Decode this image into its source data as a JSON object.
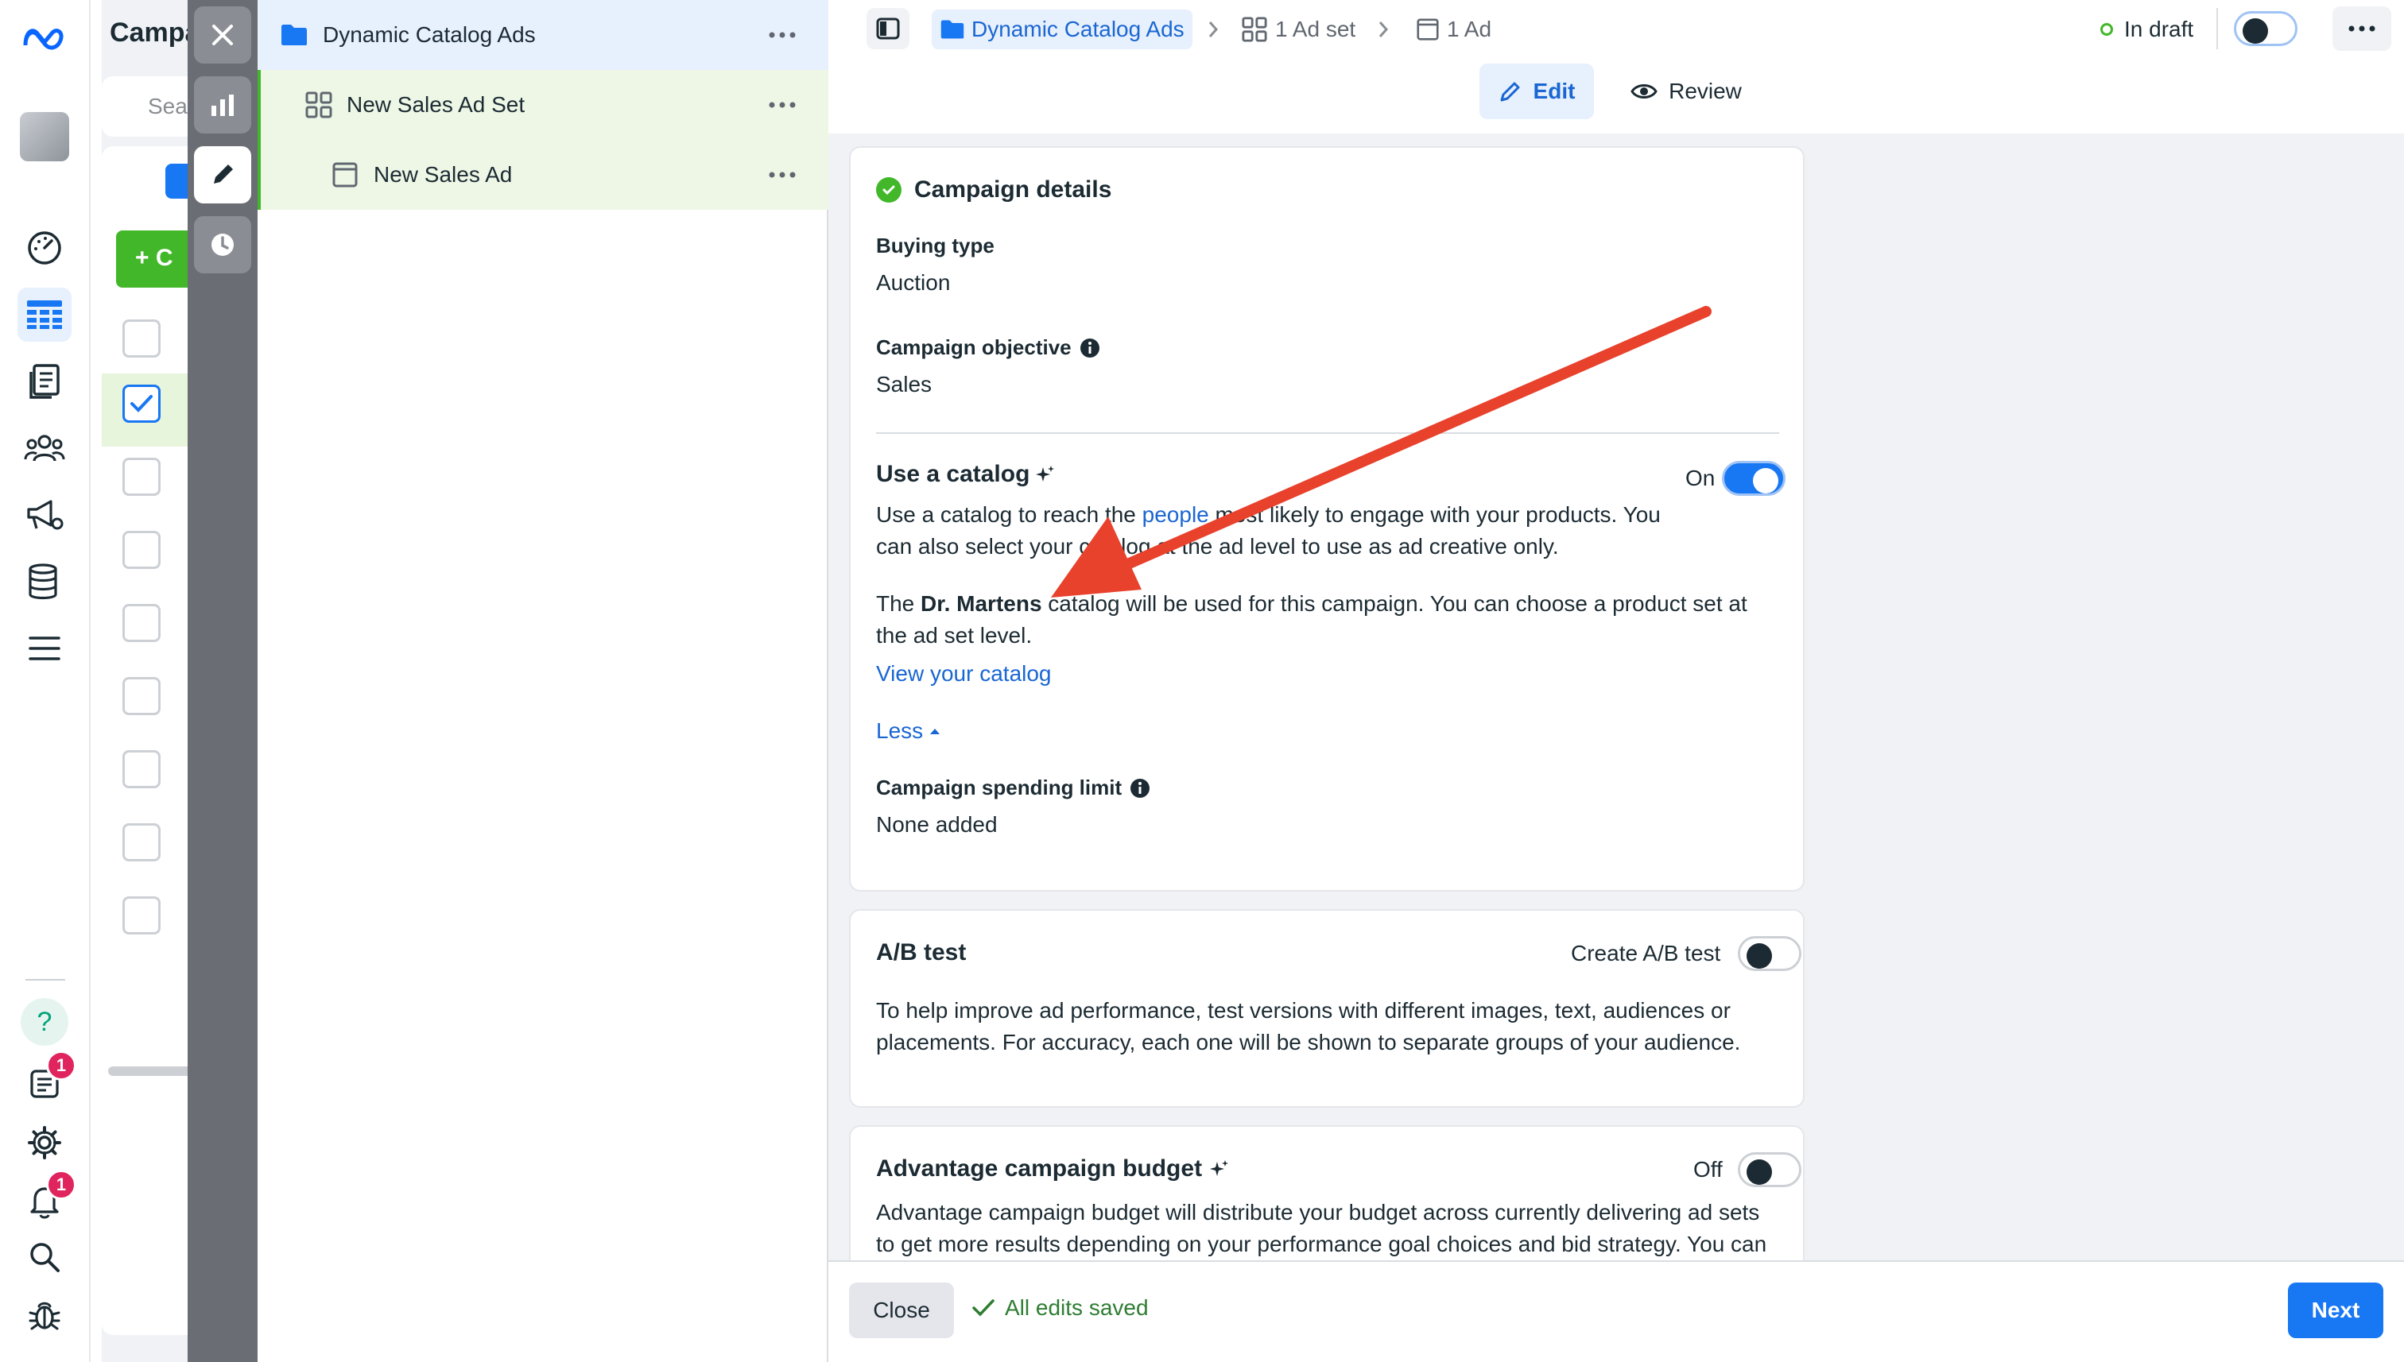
{
  "colors": {
    "accent": "#1877f2",
    "link": "#1a66d2",
    "success": "#42b72a",
    "annotation_arrow": "#e8412c",
    "badge": "#e0245e"
  },
  "rail": {
    "logo_icon": "meta-logo-icon",
    "nav_icons": [
      "dashboard-icon",
      "campaign-table-icon",
      "pages-icon",
      "audience-icon",
      "ads-megaphone-icon",
      "database-icon",
      "menu-icon"
    ],
    "bottom_icons": [
      "help-icon",
      "news-icon",
      "settings-icon",
      "notifications-icon",
      "search-icon",
      "bug-icon"
    ],
    "help_label": "?",
    "news_badge": "1",
    "notifications_badge": "1"
  },
  "background_list": {
    "title_fragment": "Campa",
    "search_fragment": "Sea",
    "create_fragment": "+ C"
  },
  "tree": {
    "campaign": "Dynamic Catalog Ads",
    "ad_set": "New Sales Ad Set",
    "ad": "New Sales Ad"
  },
  "topbar": {
    "breadcrumb_campaign": "Dynamic Catalog Ads",
    "breadcrumb_adset": "1 Ad set",
    "breadcrumb_ad": "1 Ad",
    "status": "In draft",
    "edit_tab": "Edit",
    "review_tab": "Review"
  },
  "campaign_details": {
    "title": "Campaign details",
    "buying_type_label": "Buying type",
    "buying_type_value": "Auction",
    "objective_label": "Campaign objective",
    "objective_value": "Sales",
    "catalog_title": "Use a catalog",
    "catalog_toggle_label": "On",
    "catalog_desc_1": "Use a catalog to reach the ",
    "catalog_desc_link": "people",
    "catalog_desc_2": " most likely to engage with your products. You can also select your catalog at the ad level to use as ad creative only.",
    "catalog_note_1": "The ",
    "catalog_note_bold": "Dr. Martens",
    "catalog_note_2": " catalog will be used for this campaign. You can choose a product set at the ad set level.",
    "view_catalog_link": "View your catalog",
    "less_link": "Less",
    "spending_limit_label": "Campaign spending limit",
    "spending_limit_value": "None added"
  },
  "ab_test": {
    "title": "A/B test",
    "toggle_label": "Create A/B test",
    "desc": "To help improve ad performance, test versions with different images, text, audiences or placements. For accuracy, each one will be shown to separate groups of your audience."
  },
  "advantage_budget": {
    "title": "Advantage campaign budget",
    "toggle_label": "Off",
    "desc": "Advantage campaign budget will distribute your budget across currently delivering ad sets to get more results depending on your performance goal choices and bid strategy. You can"
  },
  "footer": {
    "close": "Close",
    "saved": "All edits saved",
    "next": "Next"
  }
}
